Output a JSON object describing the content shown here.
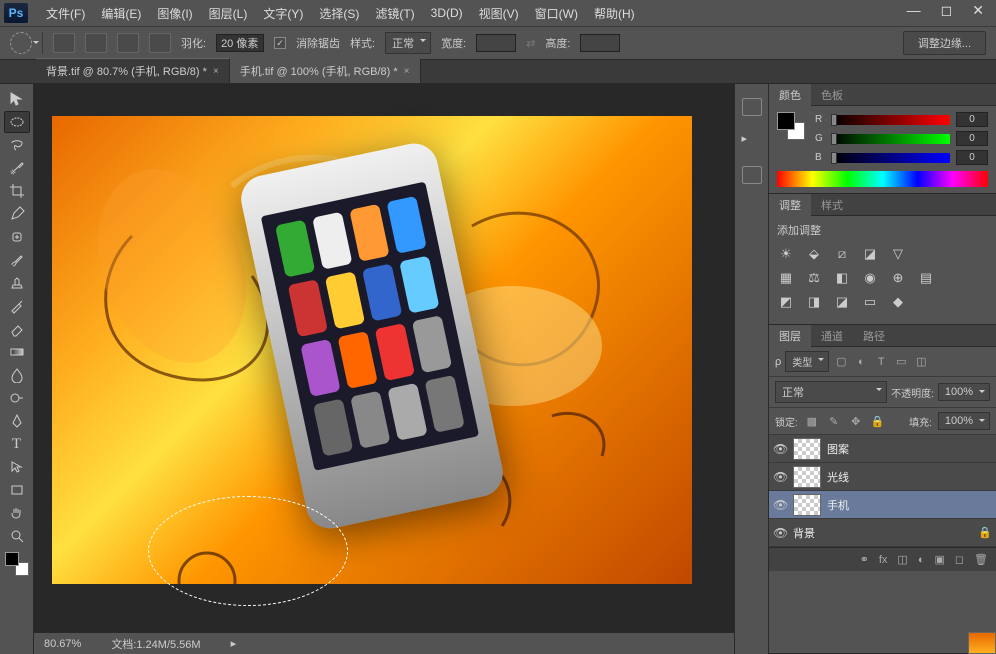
{
  "app_logo": "Ps",
  "menu": {
    "file": "文件(F)",
    "edit": "编辑(E)",
    "image": "图像(I)",
    "layer": "图层(L)",
    "type": "文字(Y)",
    "select": "选择(S)",
    "filter": "滤镜(T)",
    "threed": "3D(D)",
    "view": "视图(V)",
    "window": "窗口(W)",
    "help": "帮助(H)"
  },
  "options": {
    "feather_label": "羽化:",
    "feather_value": "20 像素",
    "antialias_label": "消除锯齿",
    "style_label": "样式:",
    "style_value": "正常",
    "width_label": "宽度:",
    "height_label": "高度:",
    "refine_edge": "调整边缘..."
  },
  "tabs": [
    {
      "label": "背景.tif @ 80.7% (手机, RGB/8) *",
      "active": true
    },
    {
      "label": "手机.tif @ 100% (手机, RGB/8) *",
      "active": false
    }
  ],
  "status": {
    "zoom": "80.67%",
    "doc": "文档:1.24M/5.56M"
  },
  "color_panel": {
    "tab_color": "颜色",
    "tab_swatches": "色板",
    "r_label": "R",
    "r_value": "0",
    "g_label": "G",
    "g_value": "0",
    "b_label": "B",
    "b_value": "0"
  },
  "adjustments_panel": {
    "tab_adjustments": "调整",
    "tab_styles": "样式",
    "title": "添加调整"
  },
  "layers_panel": {
    "tab_layers": "图层",
    "tab_channels": "通道",
    "tab_paths": "路径",
    "filter_kind": "类型",
    "blend_mode": "正常",
    "opacity_label": "不透明度:",
    "opacity_value": "100%",
    "lock_label": "锁定:",
    "fill_label": "填充:",
    "fill_value": "100%",
    "layers": [
      {
        "name": "图案",
        "visible": true,
        "locked": false
      },
      {
        "name": "光线",
        "visible": true,
        "locked": false
      },
      {
        "name": "手机",
        "visible": true,
        "locked": false,
        "selected": true
      },
      {
        "name": "背景",
        "visible": true,
        "locked": true,
        "bg": true
      }
    ]
  },
  "chart_data": null
}
